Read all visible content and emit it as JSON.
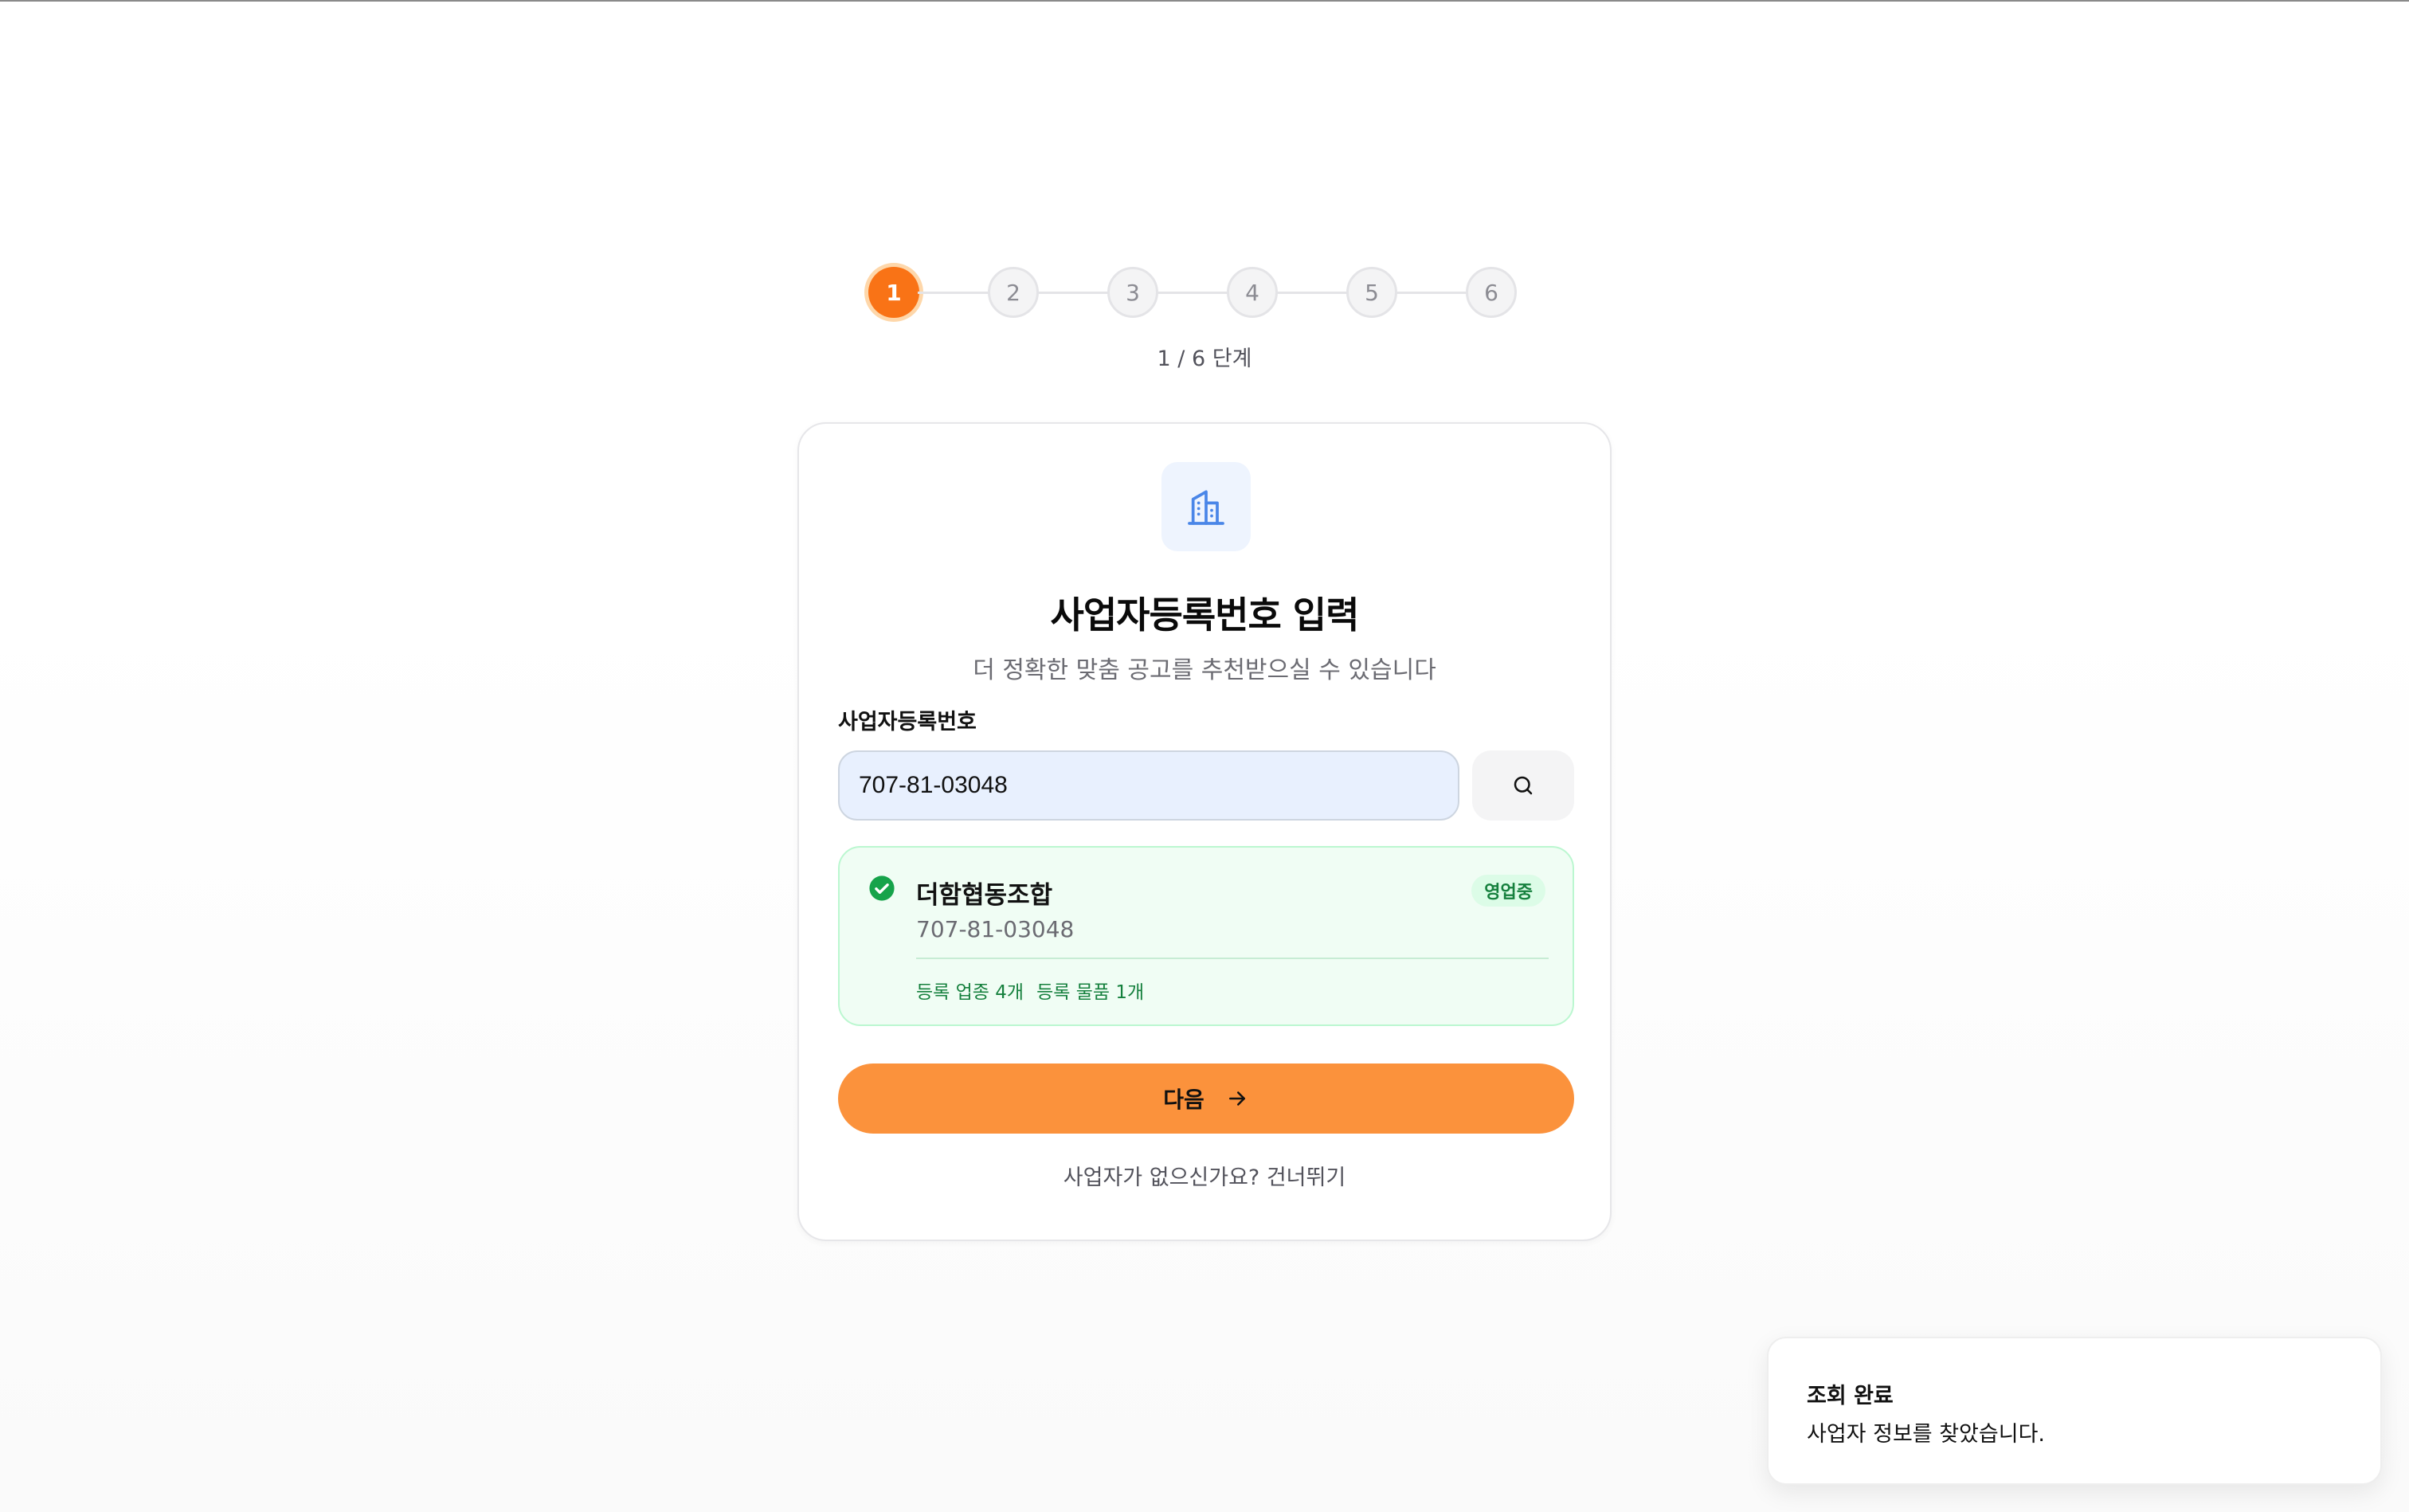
{
  "stepper": {
    "steps": [
      "1",
      "2",
      "3",
      "4",
      "5",
      "6"
    ],
    "active_index": 0,
    "progress_text": "1 / 6 단계"
  },
  "card": {
    "icon": "building-icon",
    "title": "사업자등록번호 입력",
    "subtitle": "더 정확한 맞춤 공고를 추천받으실 수 있습니다",
    "field_label": "사업자등록번호",
    "input_value": "707-81-03048",
    "search_icon": "search-icon",
    "result": {
      "company_name": "더함협동조합",
      "status": "영업중",
      "business_number": "707-81-03048",
      "industries": "등록 업종 4개",
      "products": "등록 물품 1개"
    },
    "next_label": "다음",
    "skip_text": "사업자가 없으신가요? 건너뛰기"
  },
  "toast": {
    "title": "조회 완료",
    "message": "사업자 정보를 찾았습니다."
  },
  "colors": {
    "accent": "#f97316",
    "button": "#fb923c",
    "success": "#16a34a",
    "success_bg": "#f0fdf4",
    "input_bg": "#e8f0fe",
    "icon_blue": "#4a86e8"
  }
}
